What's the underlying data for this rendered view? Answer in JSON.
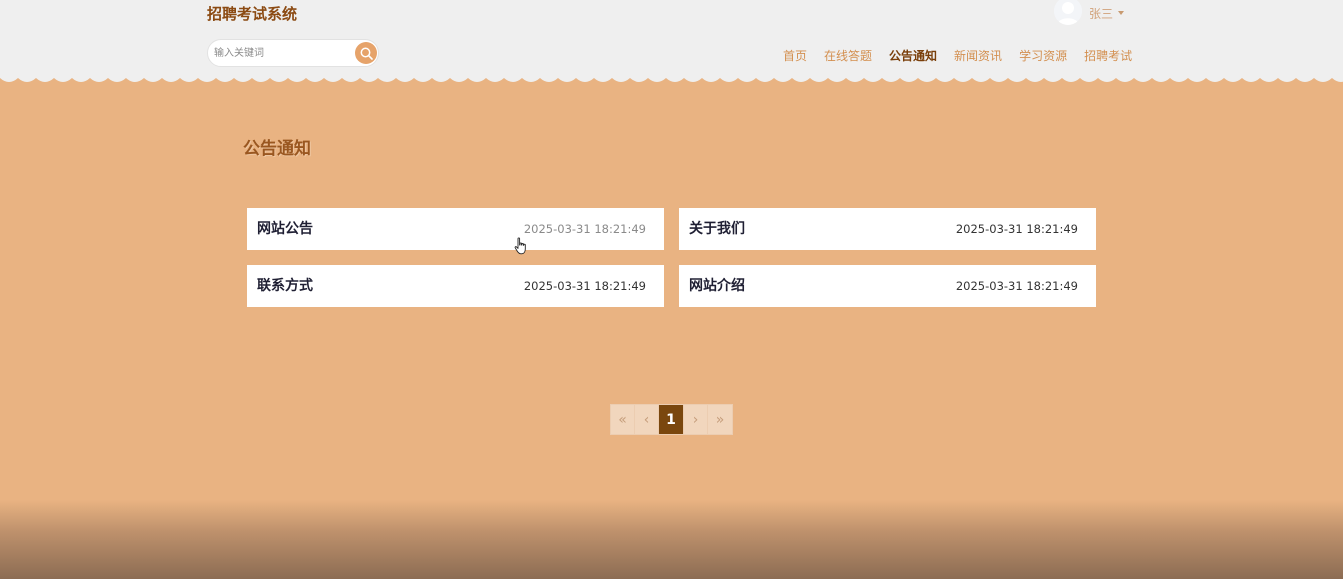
{
  "header": {
    "site_title": "招聘考试系统",
    "user": {
      "name": "张三",
      "avatar_icon": "user-avatar-icon",
      "dropdown_icon": "caret-down-icon"
    },
    "search": {
      "placeholder": "输入关键词",
      "value": "",
      "icon": "search-icon"
    },
    "nav": [
      {
        "label": "首页",
        "active": false
      },
      {
        "label": "在线答题",
        "active": false
      },
      {
        "label": "公告通知",
        "active": true
      },
      {
        "label": "新闻资讯",
        "active": false
      },
      {
        "label": "学习资源",
        "active": false
      },
      {
        "label": "招聘考试",
        "active": false
      }
    ]
  },
  "main": {
    "section_title": "公告通知",
    "notices": [
      {
        "title": "网站公告",
        "date": "2025-03-31 18:21:49"
      },
      {
        "title": "关于我们",
        "date": "2025-03-31 18:21:49"
      },
      {
        "title": "联系方式",
        "date": "2025-03-31 18:21:49"
      },
      {
        "title": "网站介绍",
        "date": "2025-03-31 18:21:49"
      }
    ],
    "pagination": {
      "first": "«",
      "prev": "‹",
      "current": "1",
      "next": "›",
      "last": "»"
    }
  },
  "colors": {
    "accent": "#e9b382",
    "brand": "#8b4a12",
    "nav_active": "#7a3f0a",
    "nav_inactive": "#d38f4f",
    "page_current": "#7a470e",
    "header_bg": "#efefef"
  }
}
